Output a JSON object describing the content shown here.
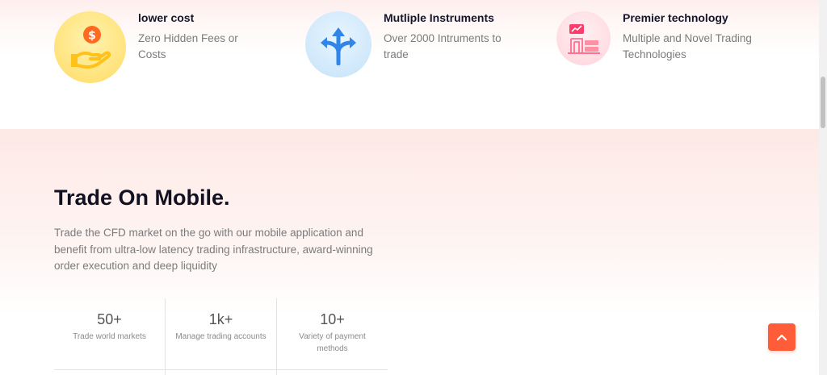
{
  "features": [
    {
      "title": "lower cost",
      "desc": "Zero Hidden Fees or Costs",
      "icon": "money-hand-icon"
    },
    {
      "title": "Mutliple Instruments",
      "desc": "Over 2000 Intruments to trade",
      "icon": "split-arrows-icon"
    },
    {
      "title": "Premier technology",
      "desc": "Multiple and Novel Trading Technologies",
      "icon": "trading-desk-icon"
    }
  ],
  "mobile": {
    "title": "Trade On Mobile.",
    "description": "Trade the CFD market on the go with our mobile application and benefit from ultra-low latency trading infrastructure, award-winning order execution and deep liquidity",
    "stats": [
      {
        "value": "50+",
        "label": "Trade world markets"
      },
      {
        "value": "1k+",
        "label": "Manage trading accounts"
      },
      {
        "value": "10+",
        "label": "Variety of payment methods"
      }
    ]
  },
  "colors": {
    "accent": "#ff5c3a",
    "heading": "#111122",
    "body_text": "#7b7b7b"
  }
}
